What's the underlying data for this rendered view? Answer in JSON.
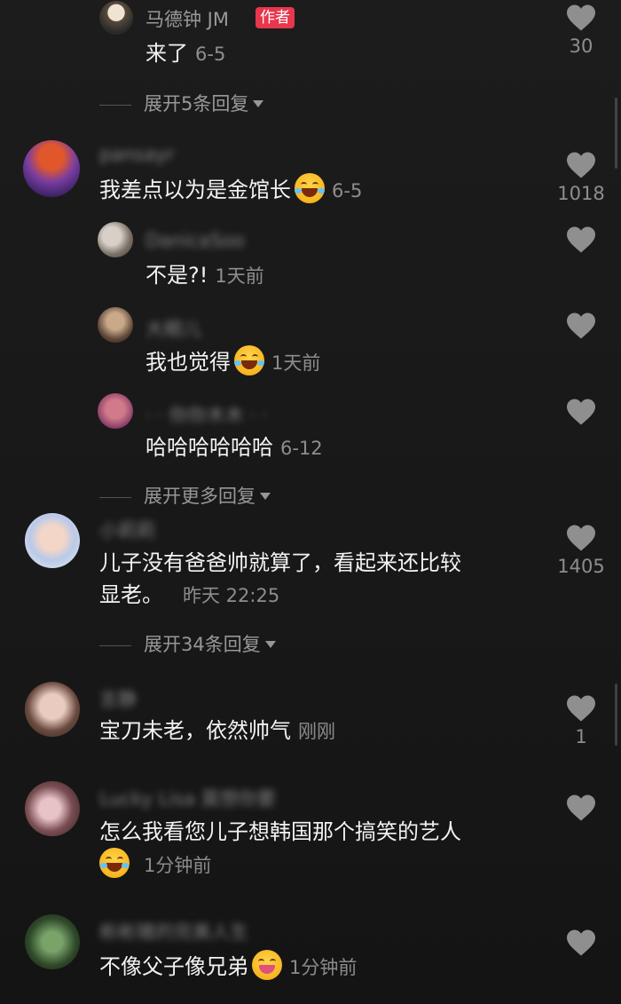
{
  "comments": [
    {
      "name": "马德钟 JM",
      "badge": "作者",
      "text": "来了",
      "time": "6-5",
      "likes": "30",
      "expand": "展开5条回复"
    },
    {
      "name": "pansayr",
      "text": "我差点以为是金馆长",
      "time": "6-5",
      "likes": "1018",
      "replies": [
        {
          "name": "DanicaSoo",
          "text": "不是?!",
          "time": "1天前"
        },
        {
          "name": "大眼儿",
          "text": "我也觉得",
          "time": "1天前"
        },
        {
          "name": "· · 你你木木 · ·",
          "text": "哈哈哈哈哈哈",
          "time": "6-12"
        }
      ],
      "expand": "展开更多回复"
    },
    {
      "name": "小莉莉",
      "text_line1": "儿子没有爸爸帅就算了，看起来还比较",
      "text_line2": "显老。",
      "time": "昨天 22:25",
      "likes": "1405",
      "expand": "展开34条回复"
    },
    {
      "name": "言静",
      "text": "宝刀未老，依然帅气",
      "time": "刚刚",
      "likes": "1"
    },
    {
      "name": "Lucky Lisa 莫想你要",
      "text_line1": "怎么我看您儿子想韩国那个搞笑的艺人",
      "time": "1分钟前"
    },
    {
      "name": "彬彬猪的完美人生",
      "text": "不像父子像兄弟",
      "time": "1分钟前"
    }
  ],
  "icons": {
    "like": "heart-icon",
    "expand": "chevron-down-icon",
    "emoji_laugh": "rofl-emoji-icon",
    "emoji_joy": "joy-emoji-icon",
    "emoji_wink": "wink-tongue-emoji-icon"
  },
  "colors": {
    "background": "#161616",
    "author_badge": "#e8364d",
    "heart": "#8f8f8f"
  }
}
